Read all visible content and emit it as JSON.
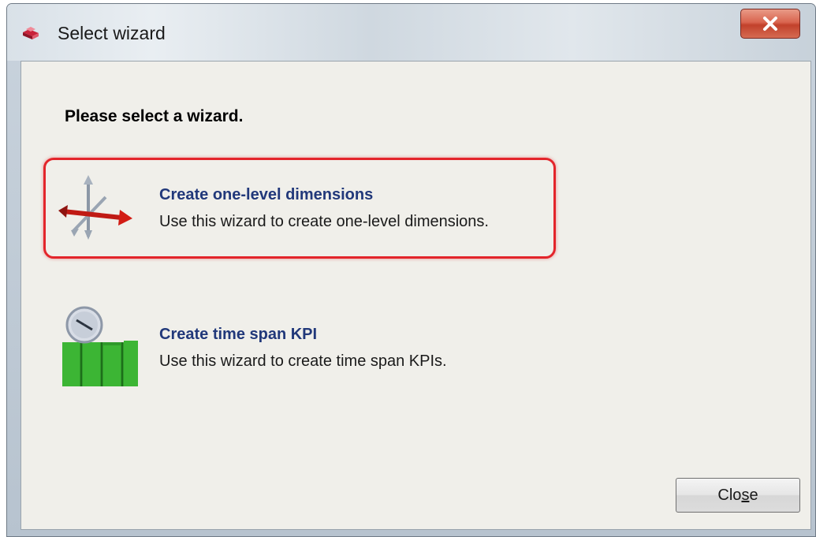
{
  "window": {
    "title": "Select wizard",
    "close_glyph": "✕",
    "app_icon": "wizard-app-icon"
  },
  "content": {
    "heading": "Please select a wizard.",
    "wizards": [
      {
        "title": "Create one-level dimensions",
        "description": "Use this wizard to create one-level dimensions.",
        "icon": "dimension-axes-icon",
        "selected": true
      },
      {
        "title": "Create time span KPI",
        "description": "Use this wizard to create time span KPIs.",
        "icon": "clock-bars-icon",
        "selected": false
      }
    ]
  },
  "footer": {
    "close_label_pre": "Clo",
    "close_label_mnemonic": "s",
    "close_label_post": "e"
  },
  "colors": {
    "selection_border": "#e3252b",
    "wizard_title": "#21387a",
    "close_button_red": "#c2412b"
  }
}
